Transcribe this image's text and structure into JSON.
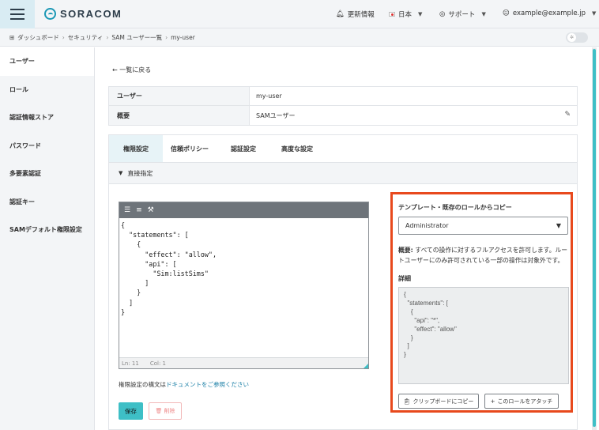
{
  "header": {
    "brand": "SORACOM",
    "updates": "更新情報",
    "language": "日本",
    "support": "サポート",
    "account": "example@example.jp"
  },
  "breadcrumb": [
    "ダッシュボード",
    "セキュリティ",
    "SAM ユーザー一覧",
    "my-user"
  ],
  "sidebar": {
    "items": [
      {
        "label": "ユーザー",
        "active": true
      },
      {
        "label": "ロール"
      },
      {
        "label": "認証情報ストア"
      },
      {
        "label": "パスワード"
      },
      {
        "label": "多要素認証"
      },
      {
        "label": "認証キー"
      },
      {
        "label": "SAMデフォルト権限設定"
      }
    ]
  },
  "main": {
    "back": "一覧に戻る",
    "info": [
      {
        "label": "ユーザー",
        "value": "my-user"
      },
      {
        "label": "概要",
        "value": "SAMユーザー"
      }
    ],
    "tabs": [
      "権限設定",
      "信頼ポリシー",
      "認証設定",
      "高度な設定"
    ],
    "section": "直接指定",
    "editor": {
      "content": "{\n  \"statements\": [\n    {\n      \"effect\": \"allow\",\n      \"api\": [\n        \"Sim:listSims\"\n      ]\n    }\n  ]\n}",
      "line": "Ln: 11",
      "col": "Col: 1"
    },
    "doc_prefix": "権限設定の構文は",
    "doc_link": "ドキュメントをご参照ください",
    "save": "保存",
    "delete": "削除"
  },
  "copy_panel": {
    "title": "テンプレート・既存のロールからコピー",
    "selected": "Administrator",
    "summary_label": "概要:",
    "summary": " すべての操作に対するフルアクセスを許可します。ルートユーザーにのみ許可されている一部の操作は対象外です。",
    "detail_label": "詳細",
    "detail": "{\n  \"statements\": [\n    {\n      \"api\": \"*\",\n      \"effect\": \"allow\"\n    }\n  ]\n}",
    "copy_clipboard": "クリップボードにコピー",
    "attach_role": "このロールをアタッチ"
  },
  "colors": {
    "accent": "#3ebfc6",
    "highlight": "#e8491d",
    "link": "#1a7fa6"
  }
}
